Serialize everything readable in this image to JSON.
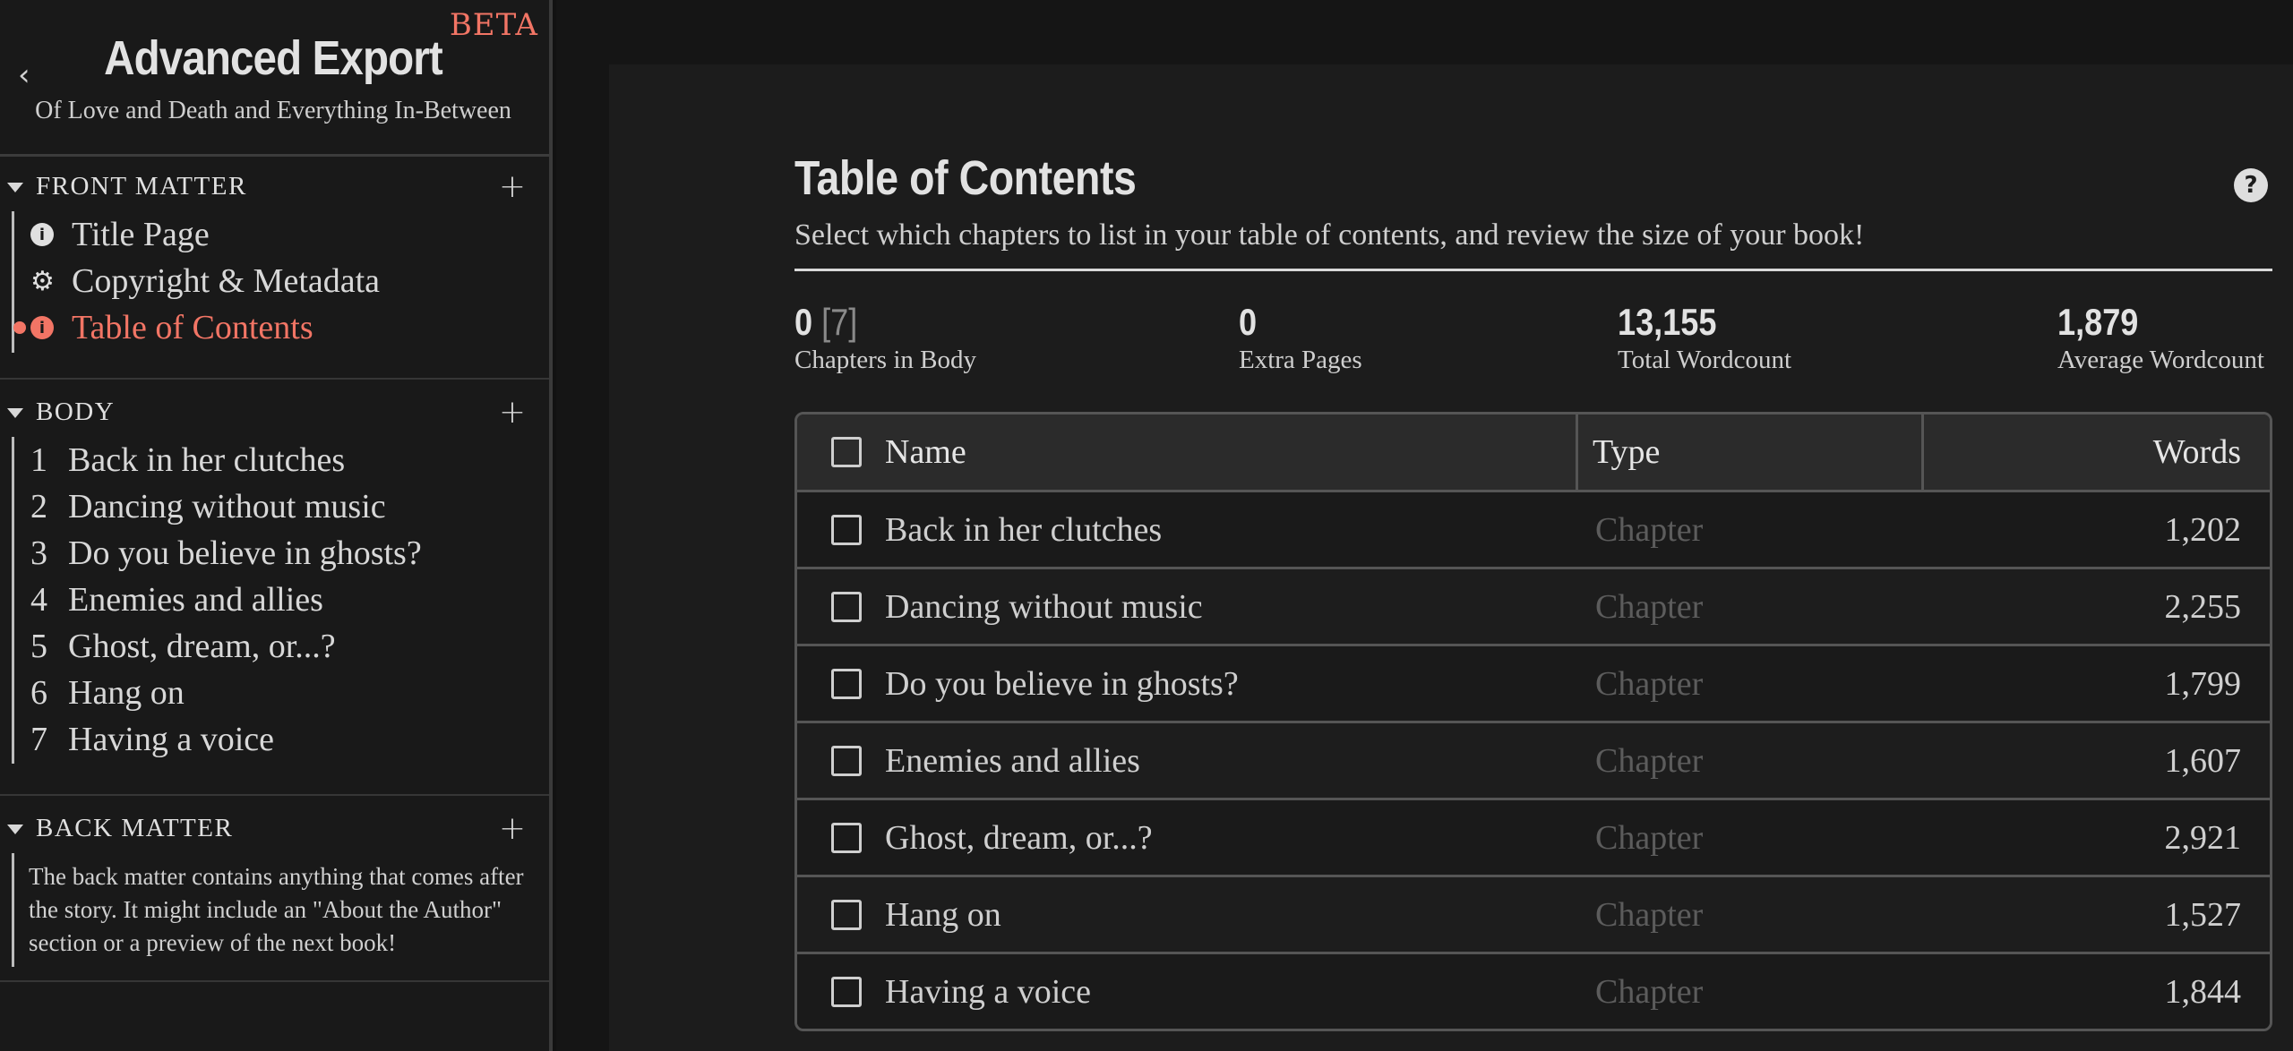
{
  "sidebar": {
    "back_icon": "chevron-left-icon",
    "beta": "BETA",
    "title": "Advanced Export",
    "subtitle": "Of Love and Death and Everything In-Between",
    "front_matter": {
      "label": "FRONT MATTER",
      "items": [
        {
          "label": "Title Page",
          "icon": "info-icon"
        },
        {
          "label": "Copyright & Metadata",
          "icon": "gear-icon"
        },
        {
          "label": "Table of Contents",
          "icon": "info-icon",
          "active": true
        }
      ]
    },
    "body": {
      "label": "BODY",
      "items": [
        {
          "num": "1",
          "label": "Back in her clutches"
        },
        {
          "num": "2",
          "label": "Dancing without music"
        },
        {
          "num": "3",
          "label": "Do you believe in ghosts?"
        },
        {
          "num": "4",
          "label": "Enemies and allies"
        },
        {
          "num": "5",
          "label": "Ghost, dream, or...?"
        },
        {
          "num": "6",
          "label": "Hang on"
        },
        {
          "num": "7",
          "label": "Having a voice"
        }
      ]
    },
    "back_matter": {
      "label": "BACK MATTER",
      "text": "The back matter contains anything that comes after the story. It might include an \"About the Author\" section or a preview of the next book!"
    }
  },
  "main": {
    "title": "Table of Contents",
    "description": "Select which chapters to list in your table of contents, and review the size of your book!",
    "stats": {
      "chapters_value": "0",
      "chapters_total": "[7]",
      "chapters_label": "Chapters in Body",
      "extra_value": "0",
      "extra_label": "Extra Pages",
      "total_value": "13,155",
      "total_label": "Total Wordcount",
      "avg_value": "1,879",
      "avg_label": "Average Wordcount"
    },
    "table": {
      "headers": {
        "name": "Name",
        "type": "Type",
        "words": "Words"
      },
      "rows": [
        {
          "name": "Back in her clutches",
          "type": "Chapter",
          "words": "1,202"
        },
        {
          "name": "Dancing without music",
          "type": "Chapter",
          "words": "2,255"
        },
        {
          "name": "Do you believe in ghosts?",
          "type": "Chapter",
          "words": "1,799"
        },
        {
          "name": "Enemies and allies",
          "type": "Chapter",
          "words": "1,607"
        },
        {
          "name": "Ghost, dream, or...?",
          "type": "Chapter",
          "words": "2,921"
        },
        {
          "name": "Hang on",
          "type": "Chapter",
          "words": "1,527"
        },
        {
          "name": "Having a voice",
          "type": "Chapter",
          "words": "1,844"
        }
      ]
    }
  },
  "colors": {
    "accent": "#f27565",
    "background": "#121212",
    "panel": "#1c1c1c"
  }
}
